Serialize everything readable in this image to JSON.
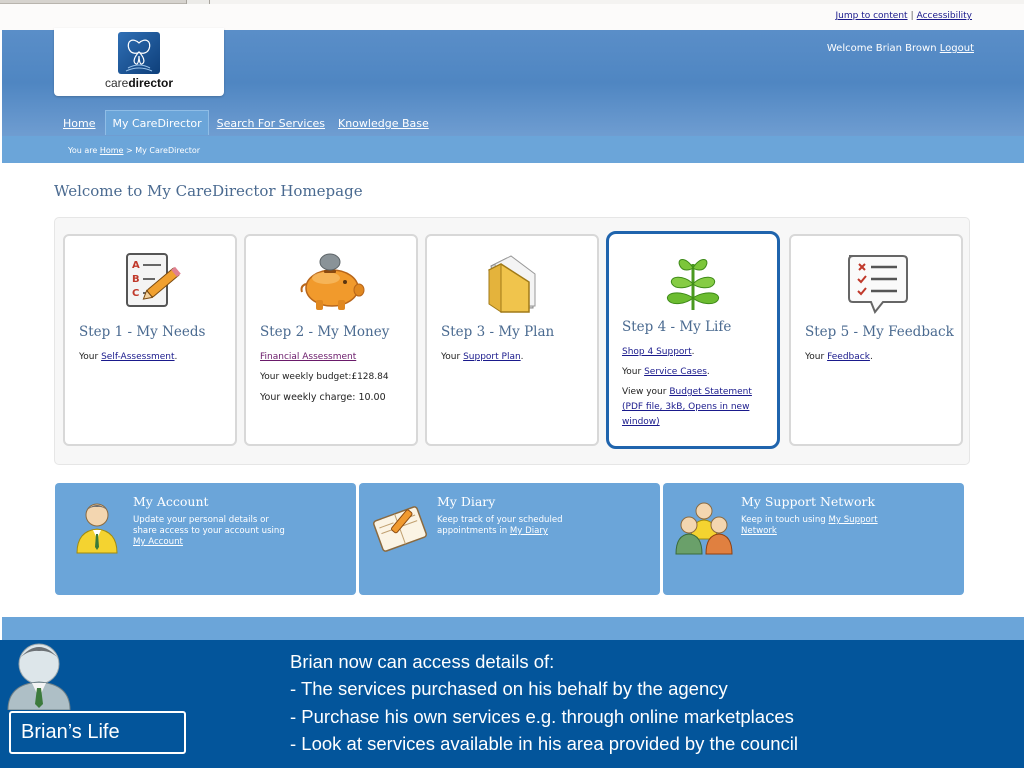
{
  "utility": {
    "jump_label": "Jump to content",
    "separator": "|",
    "accessibility_label": "Accessibility"
  },
  "logo": {
    "prefix": "care",
    "bold": "director"
  },
  "header": {
    "welcome_text": "Welcome  Brian Brown",
    "logout_label": "Logout"
  },
  "nav": [
    {
      "label": "Home"
    },
    {
      "label": "My CareDirector"
    },
    {
      "label": "Search For Services"
    },
    {
      "label": "Knowledge Base"
    }
  ],
  "breadcrumb": {
    "prefix": "You are",
    "home": "Home",
    "current": "> My CareDirector"
  },
  "page_title": "Welcome to My CareDirector Homepage",
  "steps": [
    {
      "title": "Step 1 - My Needs",
      "icon": "checklist-pencil-icon",
      "lines": {
        "a_pre": "Your ",
        "a_link": "Self-Assessment",
        "a_post": "."
      }
    },
    {
      "title": "Step 2 - My Money",
      "icon": "piggy-bank-icon",
      "lines": {
        "a_link": "Financial Assessment",
        "budget": "Your weekly budget:£128.84",
        "charge": "Your weekly charge: 10.00"
      }
    },
    {
      "title": "Step 3 - My Plan",
      "icon": "folder-icon",
      "lines": {
        "a_pre": "Your ",
        "a_link": "Support Plan",
        "a_post": "."
      }
    },
    {
      "title": "Step 4 - My Life",
      "icon": "plant-icon",
      "lines": {
        "a_link": "Shop 4 Support",
        "a_post": ".",
        "b_pre": "Your ",
        "b_link": "Service Cases",
        "b_post": ".",
        "c_pre": "View your ",
        "c_link": "Budget Statement (PDF file, 3kB, Opens in new window)"
      }
    },
    {
      "title": "Step 5 - My Feedback",
      "icon": "feedback-bubble-icon",
      "lines": {
        "a_pre": "Your ",
        "a_link": "Feedback",
        "a_post": "."
      }
    }
  ],
  "info_boxes": [
    {
      "title": "My Account",
      "text": "Update your personal details or share access to your account using ",
      "link": "My Account",
      "icon": "user-icon"
    },
    {
      "title": "My Diary",
      "text": "Keep track of your scheduled appointments in ",
      "link": "My Diary",
      "icon": "diary-icon"
    },
    {
      "title": "My Support Network",
      "text": "Keep in touch using ",
      "link": "My Support Network",
      "icon": "group-icon"
    }
  ],
  "overlay": {
    "label": "Brian’s Life",
    "lines": [
      "Brian now can access details of:",
      "- The services purchased on his behalf by the agency",
      "- Purchase his own services e.g. through online marketplaces",
      "- Look at services available in his area provided by the council"
    ]
  },
  "colors": {
    "header_blue": "#4f86c2",
    "light_blue": "#6ba5d9",
    "overlay_blue": "#03559b",
    "title_blue": "#4a6a90",
    "highlight_border": "#1f64ad"
  }
}
